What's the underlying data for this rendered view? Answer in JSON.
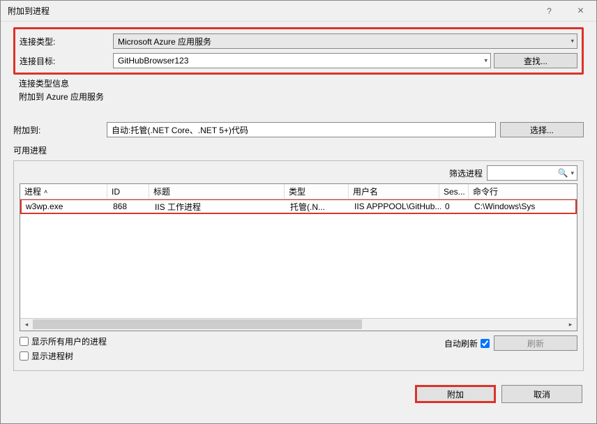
{
  "title": "附加到进程",
  "titlebar": {
    "help": "?",
    "close": "×"
  },
  "connection": {
    "type_label": "连接类型:",
    "type_value": "Microsoft Azure 应用服务",
    "target_label": "连接目标:",
    "target_value": "GitHubBrowser123",
    "find_label": "查找..."
  },
  "info": {
    "line1": "连接类型信息",
    "line2": "附加到 Azure 应用服务"
  },
  "attach_to": {
    "label": "附加到:",
    "value": "自动:托管(.NET Core、.NET 5+)代码",
    "select_label": "选择..."
  },
  "available": {
    "label": "可用进程",
    "filter_label": "筛选进程",
    "columns": {
      "proc": "进程",
      "id": "ID",
      "title": "标题",
      "type": "类型",
      "user": "用户名",
      "ses": "Ses...",
      "cmd": "命令行"
    },
    "row": {
      "proc": "w3wp.exe",
      "id": "868",
      "title": "IIS 工作进程",
      "type": "托管(.N...",
      "user": "IIS APPPOOL\\GitHub...",
      "ses": "0",
      "cmd": "C:\\Windows\\Sys"
    }
  },
  "checks": {
    "show_all": "显示所有用户的进程",
    "show_tree": "显示进程树",
    "auto_refresh": "自动刷新",
    "refresh": "刷新"
  },
  "footer": {
    "attach": "附加",
    "cancel": "取消"
  }
}
